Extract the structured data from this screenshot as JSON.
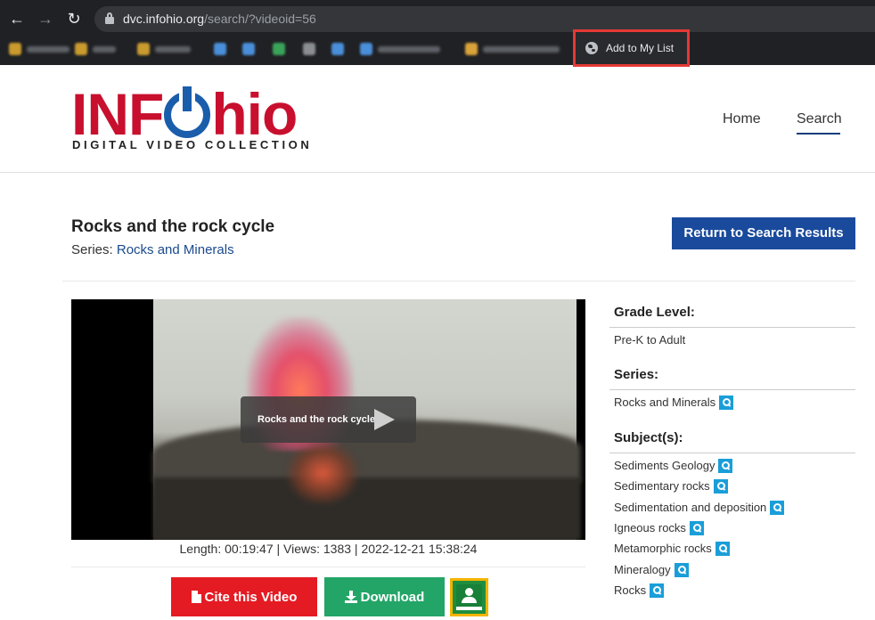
{
  "browser": {
    "url_domain": "dvc.infohio.org",
    "url_path": "/search/?videoid=56",
    "tooltip_label": "Add to My List"
  },
  "site": {
    "logo_main_left": "INF",
    "logo_main_right": "hio",
    "logo_sub": "DIGITAL VIDEO COLLECTION",
    "nav": [
      {
        "label": "Home"
      },
      {
        "label": "Search"
      }
    ]
  },
  "video": {
    "title": "Rocks and the rock cycle",
    "series_prefix": "Series:",
    "series_name": "Rocks and Minerals",
    "return_label": "Return to Search Results",
    "overlay_title": "Rocks and the rock cycle",
    "meta": "Length: 00:19:47 | Views: 1383 | 2022-12-21 15:38:24"
  },
  "actions": {
    "cite_label": "Cite this Video",
    "download_label": "Download"
  },
  "sidebar": {
    "grade_heading": "Grade Level:",
    "grade_value": "Pre-K to Adult",
    "series_heading": "Series:",
    "series_value": "Rocks and Minerals",
    "subjects_heading": "Subject(s):",
    "subjects": [
      "Sediments Geology",
      "Sedimentary rocks",
      "Sedimentation and deposition",
      "Igneous rocks",
      "Metamorphic rocks",
      "Mineralogy",
      "Rocks"
    ]
  },
  "colors": {
    "brand_red": "#c8102e",
    "brand_blue": "#1a5dab",
    "return_button": "#1a4a9c",
    "cite_button": "#e41b23",
    "download_button": "#23a567",
    "search_chip": "#1a9ed9",
    "highlight": "#e53935"
  }
}
